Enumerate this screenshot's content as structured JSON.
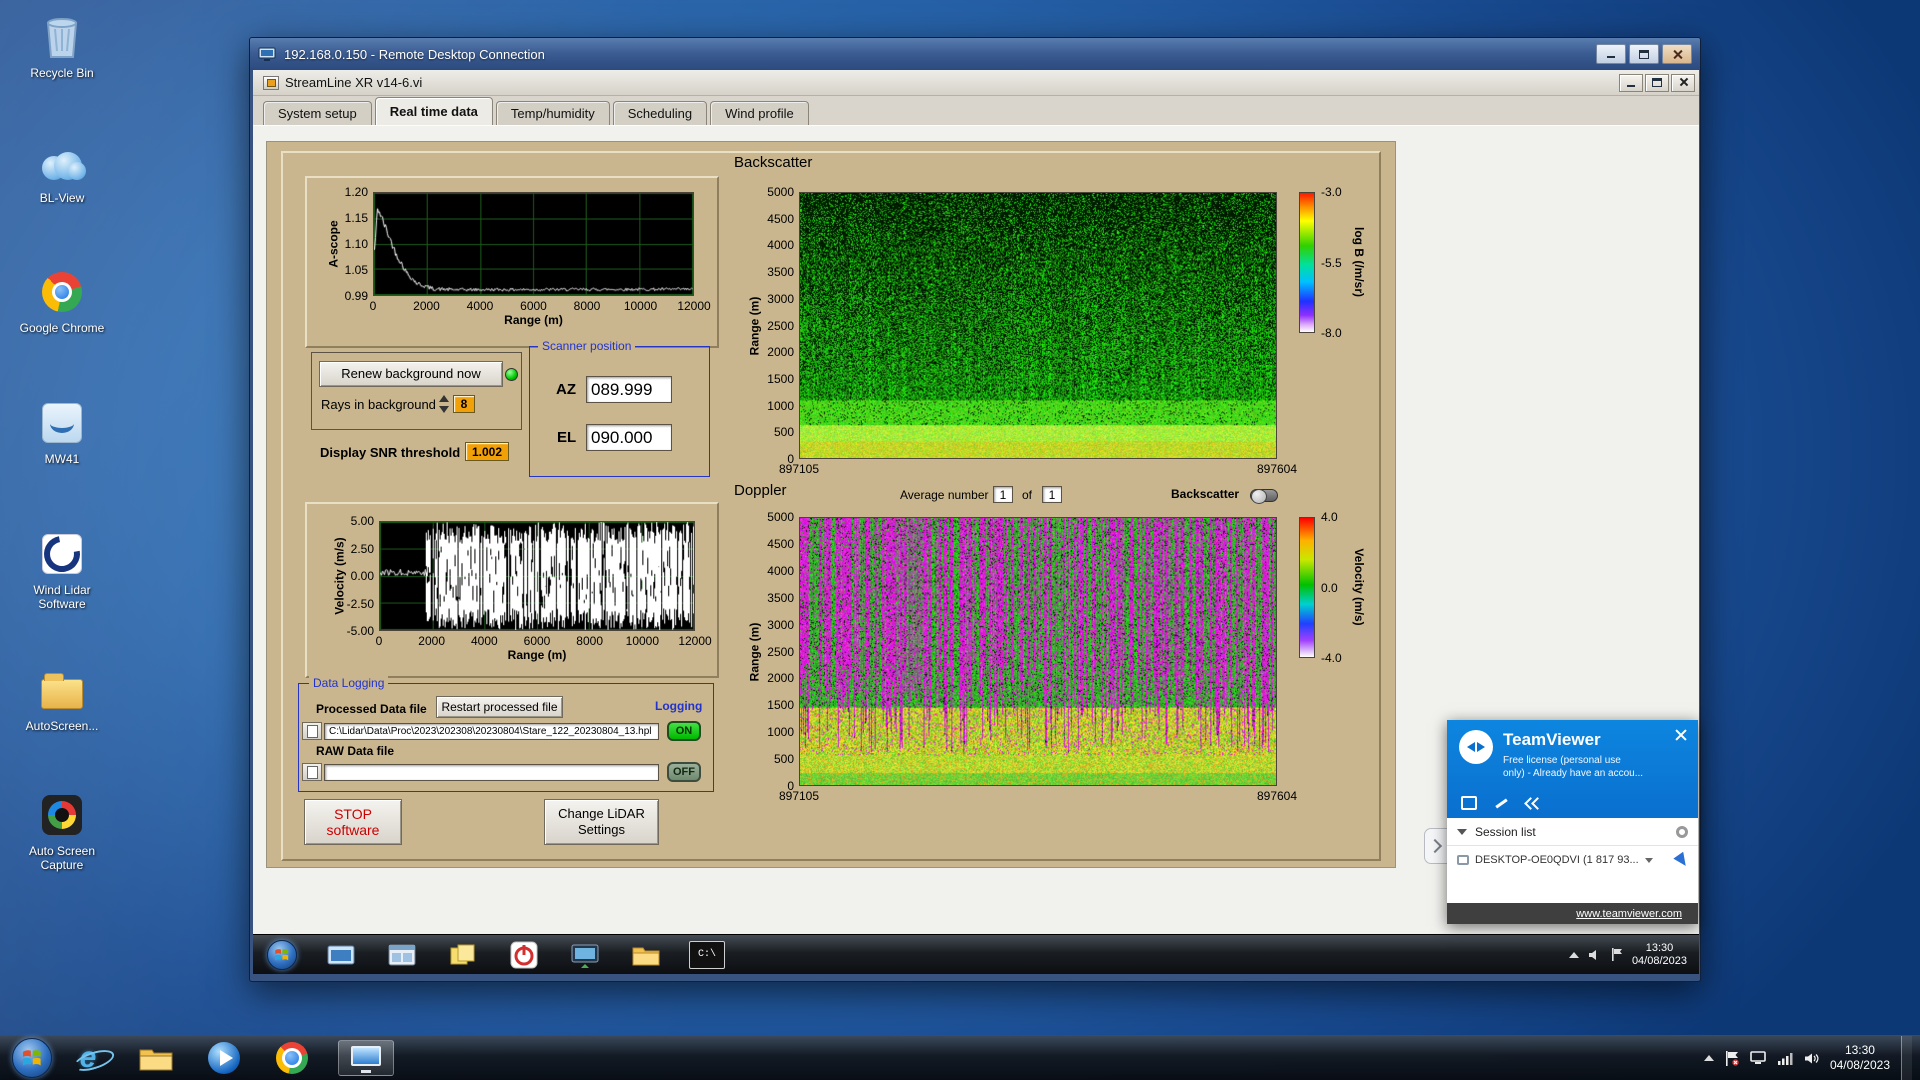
{
  "desktop": {
    "icons": [
      {
        "label": "Recycle Bin"
      },
      {
        "label": "BL-View"
      },
      {
        "label": "Google Chrome"
      },
      {
        "label": "MW41"
      },
      {
        "label": "Wind Lidar Software"
      },
      {
        "label": "AutoScreen..."
      },
      {
        "label": "Auto Screen Capture"
      }
    ]
  },
  "rdp": {
    "title": "192.168.0.150 - Remote Desktop Connection",
    "cmd_icon_text": "C:\\",
    "clock": {
      "time": "13:30",
      "date": "04/08/2023"
    }
  },
  "app": {
    "title": "StreamLine XR v14-6.vi",
    "tabs": [
      "System setup",
      "Real time data",
      "Temp/humidity",
      "Scheduling",
      "Wind profile"
    ],
    "controls": {
      "renew_button": "Renew background now",
      "rays_label": "Rays in background",
      "rays_value": "8",
      "snr_label": "Display SNR threshold",
      "snr_value": "1.002",
      "scanner_title": "Scanner position",
      "az_label": "AZ",
      "az_value": "089.999",
      "el_label": "EL",
      "el_value": "090.000",
      "average_label": "Average number",
      "average_value": "1",
      "of_label": "of",
      "of_count": "1",
      "backscatter_toggle_label": "Backscatter",
      "datalog_title": "Data Logging",
      "processed_label": "Processed Data file",
      "restart_button": "Restart processed file",
      "logging_label": "Logging",
      "processed_path": "C:\\Lidar\\Data\\Proc\\2023\\202308\\20230804\\Stare_122_20230804_13.hpl",
      "raw_label": "RAW Data file",
      "raw_path": "",
      "on_label": "ON",
      "off_label": "OFF",
      "stop_line1": "STOP",
      "stop_line2": "software",
      "change_line1": "Change LiDAR",
      "change_line2": "Settings"
    }
  },
  "teamviewer": {
    "brand": "TeamViewer",
    "license_line1": "Free license (personal use",
    "license_line2": "only) - Already have an accou...",
    "session_list_label": "Session list",
    "entry_label": "DESKTOP-OE0QDVI (1 817 93...",
    "link": "www.teamviewer.com"
  },
  "system_clock": {
    "time": "13:30",
    "date": "04/08/2023"
  },
  "chart_data": [
    {
      "id": "ascope",
      "type": "line",
      "title": "",
      "ylabel": "A-scope",
      "xlabel": "Range (m)",
      "xlim": [
        0,
        12000
      ],
      "ylim": [
        0.99,
        1.2
      ],
      "xticks": [
        "0",
        "2000",
        "4000",
        "6000",
        "8000",
        "10000",
        "12000"
      ],
      "yticks": [
        "1.20",
        "1.15",
        "1.10",
        "1.05",
        "0.99"
      ],
      "series": [
        {
          "name": "background",
          "keypoints": [
            [
              0,
              1.08
            ],
            [
              120,
              1.17
            ],
            [
              400,
              1.13
            ],
            [
              800,
              1.075
            ],
            [
              1200,
              1.035
            ],
            [
              1600,
              1.012
            ],
            [
              2200,
              1.001
            ],
            [
              3000,
              0.999
            ],
            [
              12000,
              1.0
            ]
          ],
          "noise": 0.003
        }
      ],
      "bg": "#000000",
      "grid_color": "#1c5c1c",
      "line_color": "#ffffff",
      "seed": 42
    },
    {
      "id": "velocity",
      "type": "line",
      "title": "",
      "ylabel": "Velocity (m/s)",
      "xlabel": "Range (m)",
      "xlim": [
        0,
        12000
      ],
      "ylim": [
        -5,
        5
      ],
      "xticks": [
        "0",
        "2000",
        "4000",
        "6000",
        "8000",
        "10000",
        "12000"
      ],
      "yticks": [
        "5.00",
        "2.50",
        "0.00",
        "-2.50",
        "-5.00"
      ],
      "segments": [
        {
          "x0": 0,
          "x1": 1750,
          "mode": "line",
          "base": 0.3,
          "noise": 0.3
        },
        {
          "x0": 1750,
          "x1": 12000,
          "mode": "noise_fill",
          "min": -5,
          "max": 5,
          "density": 0.85
        }
      ],
      "bg": "#000000",
      "grid_color": "#1c5c1c",
      "line_color": "#ffffff",
      "seed": 77
    },
    {
      "id": "backscatter",
      "type": "heatmap",
      "model": "backscatter",
      "title": "Backscatter",
      "ylabel": "Range (m)",
      "ylim": [
        0,
        5000
      ],
      "yticks": [
        "5000",
        "4500",
        "4000",
        "3500",
        "3000",
        "2500",
        "2000",
        "1500",
        "1000",
        "500",
        "0"
      ],
      "xticks": [
        "897105",
        "897604"
      ],
      "colorbar": {
        "label": "log B (/m/sr)",
        "ticks": [
          "-3.0",
          "-5.5",
          "-8.0"
        ],
        "stops": [
          "#ff1800",
          "#ff9000 10%",
          "#ffff00 20%",
          "#30d000 38%",
          "#00e0a0 52%",
          "#00c0ff 64%",
          "#2030ff 78%",
          "#9030ff 88%",
          "#e0b0ff 95%",
          "#ffffff"
        ]
      },
      "description": "Attenuated backscatter time-height plot: green speckle noise thinning with altitude, bright yellow-green band below ~600 m",
      "seed": 11
    },
    {
      "id": "doppler",
      "type": "heatmap",
      "model": "doppler",
      "title": "Doppler",
      "ylabel": "Range (m)",
      "ylim": [
        0,
        5000
      ],
      "yticks": [
        "5000",
        "4500",
        "4000",
        "3500",
        "3000",
        "2500",
        "2000",
        "1500",
        "1000",
        "500",
        "0"
      ],
      "xticks": [
        "897105",
        "897604"
      ],
      "colorbar": {
        "label": "Velocity (m/s)",
        "ticks": [
          "4.0",
          "0.0",
          "-4.0"
        ],
        "stops": [
          "#ff0000",
          "#ffb000 16%",
          "#c8e800 30%",
          "#00c000 48%",
          "#00d0d0 62%",
          "#2040ff 76%",
          "#a040ff 88%",
          "#ffffff"
        ]
      },
      "description": "Doppler velocity time-height plot: vertical magenta/green noise streaks above ~1.5 km, yellow-green mix near surface",
      "seed": 23
    }
  ]
}
